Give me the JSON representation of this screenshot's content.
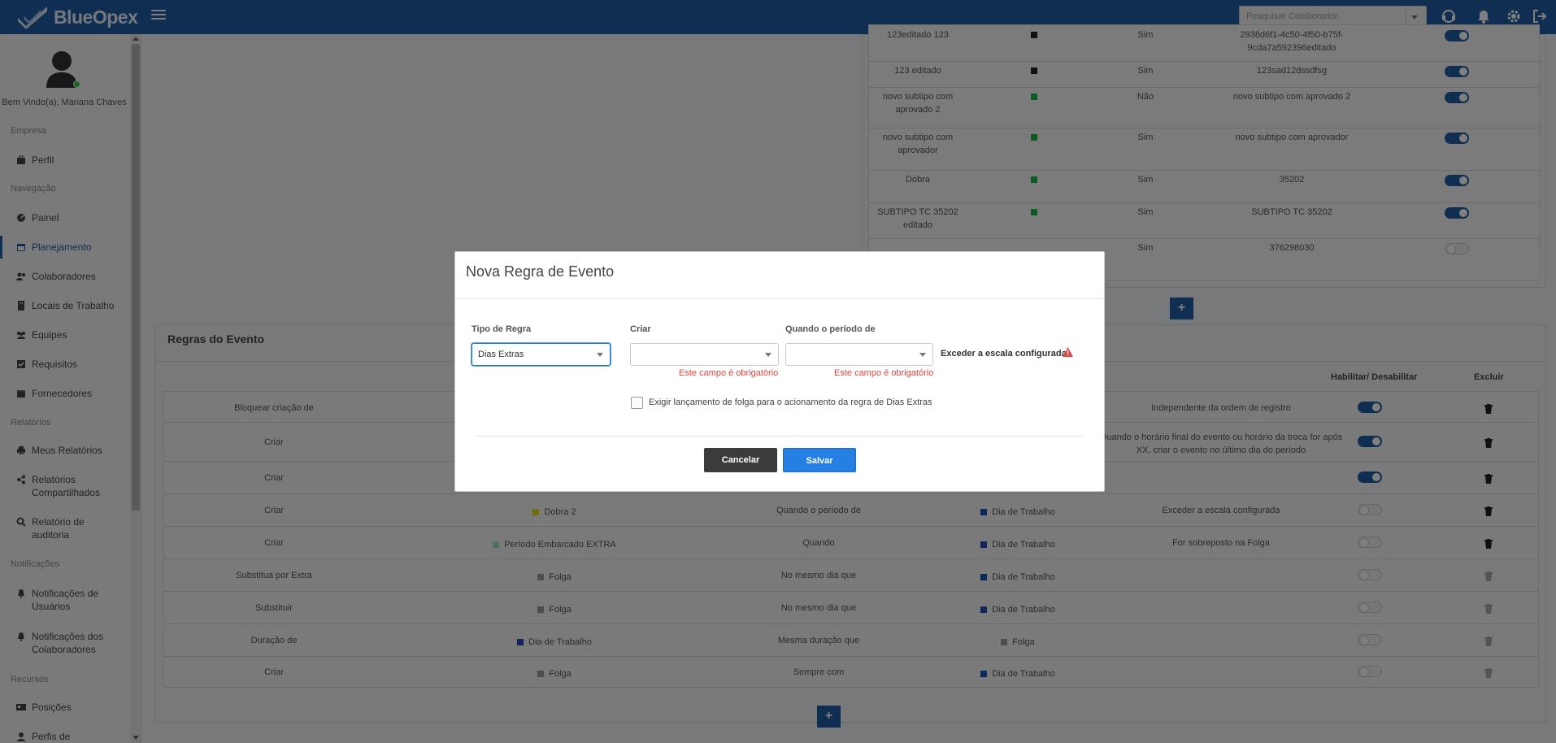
{
  "app": {
    "brand": "BlueOpex",
    "search_placeholder": "Pesquisar Colaborador"
  },
  "sidebar": {
    "welcome": "Bem Vindo(a), Mariana Chaves",
    "sections": {
      "empresa": "Empresa",
      "navegacao": "Navegação",
      "relatorios": "Relatórios",
      "notificacoes": "Notificações",
      "recursos": "Recursos"
    },
    "items": {
      "perfil": "Perfil",
      "painel": "Painel",
      "planejamento": "Planejamento",
      "colaboradores": "Colaboradores",
      "locais": "Locais de Trabalho",
      "equipes": "Equipes",
      "requisitos": "Requisitos",
      "fornecedores": "Fornecedores",
      "meus_relatorios": "Meus Relatórios",
      "relatorios_compartilhados": "Relatórios Compartilhados",
      "relatorio_auditoria": "Relatório de auditoria",
      "notif_usuarios": "Notificações de Usuários",
      "notif_colaboradores": "Notificações dos Colaboradores",
      "posicoes": "Posições",
      "perfis": "Perfis de"
    }
  },
  "subtypes_table": {
    "rows": [
      {
        "name": "123editado 123",
        "color": "#222222",
        "active": "Sim",
        "code": "2938d6f1-4c50-4f50-b75f-9cda7a592396editado",
        "enabled": true
      },
      {
        "name": "123 editado",
        "color": "#222222",
        "active": "Sim",
        "code": "123sad12dssdfsg",
        "enabled": true
      },
      {
        "name": "novo subtipo com aprovado 2",
        "color": "#19b64a",
        "active": "Não",
        "code": "novo subtipo com aprovado 2",
        "enabled": true
      },
      {
        "name": "novo subtipo com aprovador",
        "color": "#19b64a",
        "active": "Sim",
        "code": "novo subtipo com aprovador",
        "enabled": true
      },
      {
        "name": "Dobra",
        "color": "#19b64a",
        "active": "Sim",
        "code": "35202",
        "enabled": true
      },
      {
        "name": "SUBTIPO TC 35202 editado",
        "color": "#19b64a",
        "active": "Sim",
        "code": "SUBTIPO TC 35202",
        "enabled": true
      },
      {
        "name": "",
        "color": "",
        "active": "Sim",
        "code": "376298030",
        "enabled": false
      }
    ]
  },
  "rules": {
    "title": "Regras do Evento",
    "headers": {
      "toggle": "Habilitar/ Desabilitar",
      "delete": "Excluir"
    },
    "rows": [
      {
        "action": "Bloquear criação de",
        "event": "",
        "event_color": "",
        "condition": "",
        "target": "",
        "target_color": "",
        "extra": "Independente da ordem de registro",
        "enabled": true
      },
      {
        "action": "Criar",
        "event": "",
        "event_color": "",
        "condition": "",
        "target": "",
        "target_color": "",
        "extra": "Quando o horário final do evento ou horário da troca for após XX, criar o evento no último dia do período",
        "enabled": true
      },
      {
        "action": "Criar",
        "event": "",
        "event_color": "",
        "condition": "",
        "target": "",
        "target_color": "",
        "extra": "",
        "enabled": true
      },
      {
        "action": "Criar",
        "event": "Dobra 2",
        "event_color": "#e6d81f",
        "condition": "Quando o período de",
        "target": "Dia de Trabalho",
        "target_color": "#1f4fb5",
        "extra": "Exceder a escala configurada",
        "enabled": false
      },
      {
        "action": "Criar",
        "event": "Período Embarcado EXTRA",
        "event_color": "#9ee0b8",
        "condition": "Quando",
        "target": "Dia de Trabalho",
        "target_color": "#1f4fb5",
        "extra": "For sobreposto na Folga",
        "enabled": false
      },
      {
        "action": "Substitua por Extra",
        "event": "Folga",
        "event_color": "#9a9a9a",
        "condition": "No mesmo dia que",
        "target": "Dia de Trabalho",
        "target_color": "#1f4fb5",
        "extra": "",
        "enabled": false
      },
      {
        "action": "Substituir",
        "event": "Folga",
        "event_color": "#9a9a9a",
        "condition": "No mesmo dia que",
        "target": "Dia de Trabalho",
        "target_color": "#1f4fb5",
        "extra": "",
        "enabled": false
      },
      {
        "action": "Duração de",
        "event": "Dia de Trabalho",
        "event_color": "#1f4fb5",
        "condition": "Mesma duração que",
        "target": "Folga",
        "target_color": "#9a9a9a",
        "extra": "",
        "enabled": false
      },
      {
        "action": "Criar",
        "event": "Folga",
        "event_color": "#9a9a9a",
        "condition": "Sempre com",
        "target": "Dia de Trabalho",
        "target_color": "#1f4fb5",
        "extra": "",
        "enabled": false
      }
    ]
  },
  "modal": {
    "title": "Nova Regra de Evento",
    "rule_type_label": "Tipo de Regra",
    "rule_type_value": "Dias Extras",
    "create_label": "Criar",
    "create_value": "",
    "when_label": "Quando o período de",
    "when_value": "",
    "required_error": "Este campo é obrigatório",
    "exceed_label": "Exceder a escala configurada",
    "checkbox_label": "Exigir lançamento de folga para o acionamento da regra de Dias Extras",
    "cancel": "Cancelar",
    "save": "Salvar"
  },
  "colors": {
    "primary": "#1f5ca3",
    "save_button": "#2680e3",
    "error": "#e0443c",
    "warning": "#e0443c"
  }
}
